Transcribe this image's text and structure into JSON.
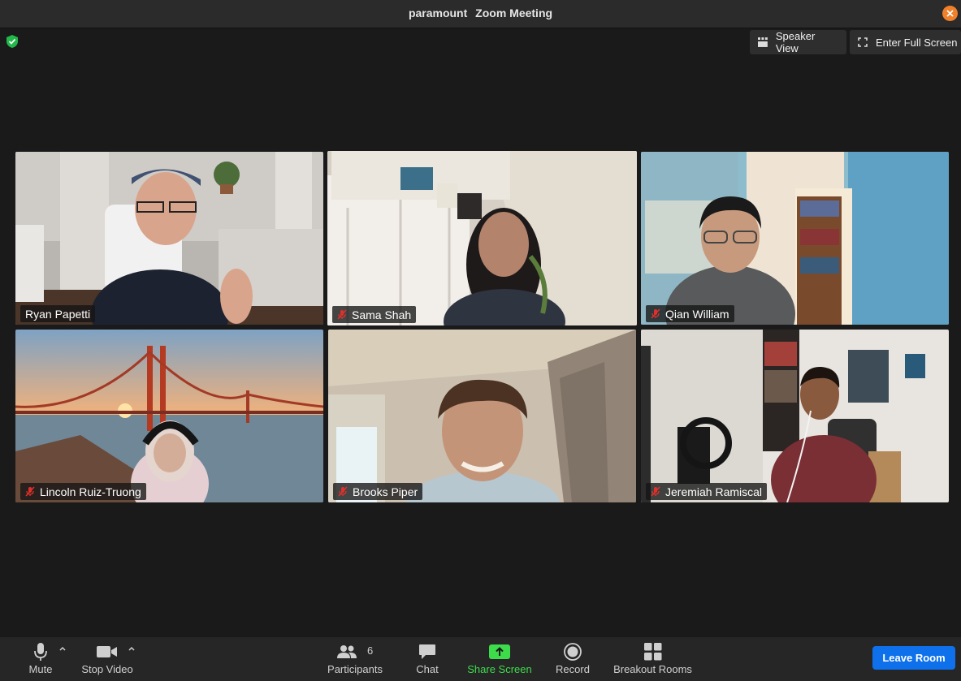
{
  "window": {
    "host": "paramount",
    "title": "Zoom Meeting"
  },
  "view_controls": {
    "speaker_view": "Speaker View",
    "full_screen": "Enter Full Screen"
  },
  "participants": [
    {
      "name": "Ryan Papetti",
      "muted": false,
      "active": false
    },
    {
      "name": "Sama Shah",
      "muted": true,
      "active": true
    },
    {
      "name": "Qian William",
      "muted": true,
      "active": false
    },
    {
      "name": "Lincoln Ruiz-Truong",
      "muted": true,
      "active": false
    },
    {
      "name": "Brooks Piper",
      "muted": true,
      "active": false
    },
    {
      "name": "Jeremiah Ramiscal",
      "muted": true,
      "active": false
    }
  ],
  "toolbar": {
    "mute": "Mute",
    "stop_video": "Stop Video",
    "participants": "Participants",
    "participant_count": "6",
    "chat": "Chat",
    "share_screen": "Share Screen",
    "record": "Record",
    "breakout_rooms": "Breakout Rooms",
    "leave_room": "Leave Room"
  },
  "colors": {
    "active_speaker": "#3ecf43",
    "share_green": "#3ddc4b",
    "leave_blue": "#0e71eb",
    "close_orange": "#f0802a",
    "muted_red": "#e0302b"
  }
}
